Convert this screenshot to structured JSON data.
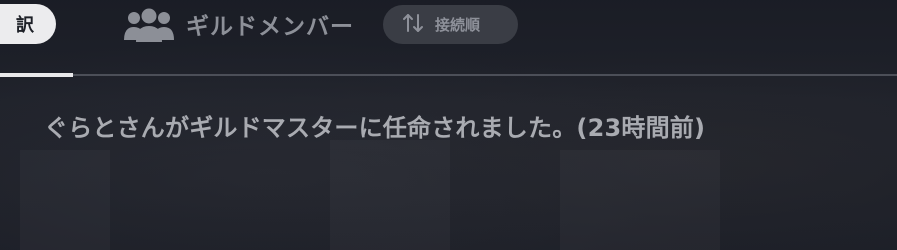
{
  "tabs": {
    "current_label": "訳",
    "members_label": "ギルドメンバー",
    "members_icon": "group-icon",
    "sort_label": "接続順",
    "sort_icon": "sort-arrows-icon"
  },
  "activity": {
    "message": "ぐらとさんがギルドマスターに任命されました。(23時間前)"
  },
  "colors": {
    "background": "#20232c",
    "text_muted": "#8d9098",
    "pill_active": "#ececee",
    "sort_bg": "#3a3d45",
    "divider": "#4c4f58"
  }
}
